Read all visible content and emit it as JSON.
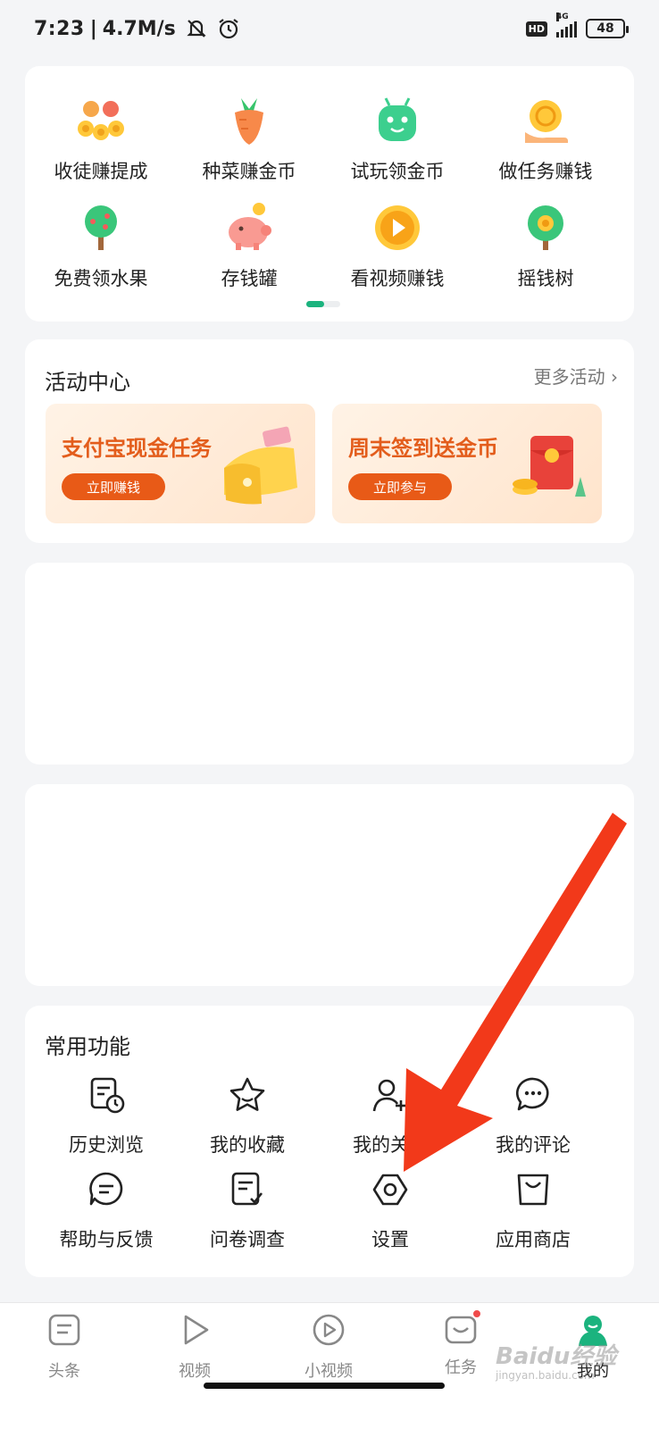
{
  "status_bar": {
    "time": "7:23",
    "speed": "4.7M/s",
    "network_label": "4G",
    "hd_label": "HD",
    "battery": "48"
  },
  "earn_grid": [
    {
      "label": "收徒赚提成",
      "icon": "coins-people-icon"
    },
    {
      "label": "种菜赚金币",
      "icon": "carrot-icon"
    },
    {
      "label": "试玩领金币",
      "icon": "android-icon"
    },
    {
      "label": "做任务赚钱",
      "icon": "coin-hand-icon"
    },
    {
      "label": "免费领水果",
      "icon": "tree-icon"
    },
    {
      "label": "存钱罐",
      "icon": "piggy-bank-icon"
    },
    {
      "label": "看视频赚钱",
      "icon": "play-coin-icon"
    },
    {
      "label": "摇钱树",
      "icon": "money-tree-icon"
    }
  ],
  "activity": {
    "title": "活动中心",
    "more": "更多活动 ›",
    "promos": [
      {
        "title": "支付宝现金任务",
        "button": "立即赚钱"
      },
      {
        "title": "周末签到送金币",
        "button": "立即参与"
      }
    ]
  },
  "common": {
    "title": "常用功能",
    "items": [
      {
        "label": "历史浏览",
        "icon": "history-icon"
      },
      {
        "label": "我的收藏",
        "icon": "star-icon"
      },
      {
        "label": "我的关注",
        "icon": "add-user-icon"
      },
      {
        "label": "我的评论",
        "icon": "comment-icon"
      },
      {
        "label": "帮助与反馈",
        "icon": "feedback-icon"
      },
      {
        "label": "问卷调查",
        "icon": "survey-icon"
      },
      {
        "label": "设置",
        "icon": "settings-icon"
      },
      {
        "label": "应用商店",
        "icon": "shopping-bag-icon"
      }
    ]
  },
  "nav": [
    {
      "label": "头条",
      "icon": "news-icon"
    },
    {
      "label": "视频",
      "icon": "video-icon"
    },
    {
      "label": "小视频",
      "icon": "short-video-icon"
    },
    {
      "label": "任务",
      "icon": "task-icon"
    },
    {
      "label": "我的",
      "icon": "profile-icon",
      "active": true
    }
  ],
  "watermark": {
    "brand": "Baidu经验",
    "url": "jingyan.baidu.com"
  },
  "colors": {
    "accent": "#1bb37e",
    "promo_orange": "#e85a17",
    "arrow_red": "#f2391a"
  }
}
